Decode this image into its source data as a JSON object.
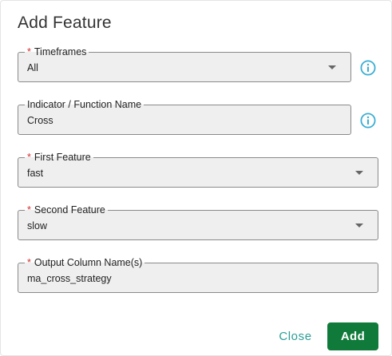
{
  "dialog": {
    "title": "Add Feature"
  },
  "fields": {
    "timeframes": {
      "required_mark": "*",
      "label": "Timeframes",
      "value": "All",
      "icon": "info-icon"
    },
    "indicator": {
      "label": "Indicator / Function Name",
      "value": "Cross",
      "icon": "info-icon"
    },
    "first_feature": {
      "required_mark": "*",
      "label": "First Feature",
      "value": "fast"
    },
    "second_feature": {
      "required_mark": "*",
      "label": "Second Feature",
      "value": "slow"
    },
    "output_columns": {
      "required_mark": "*",
      "label": "Output Column Name(s)",
      "value": "ma_cross_strategy"
    }
  },
  "actions": {
    "close_label": "Close",
    "add_label": "Add"
  },
  "colors": {
    "required": "#d32f2f",
    "info_icon": "#3aaed4",
    "close_text": "#2a9d96",
    "add_button": "#0f7a3a"
  }
}
